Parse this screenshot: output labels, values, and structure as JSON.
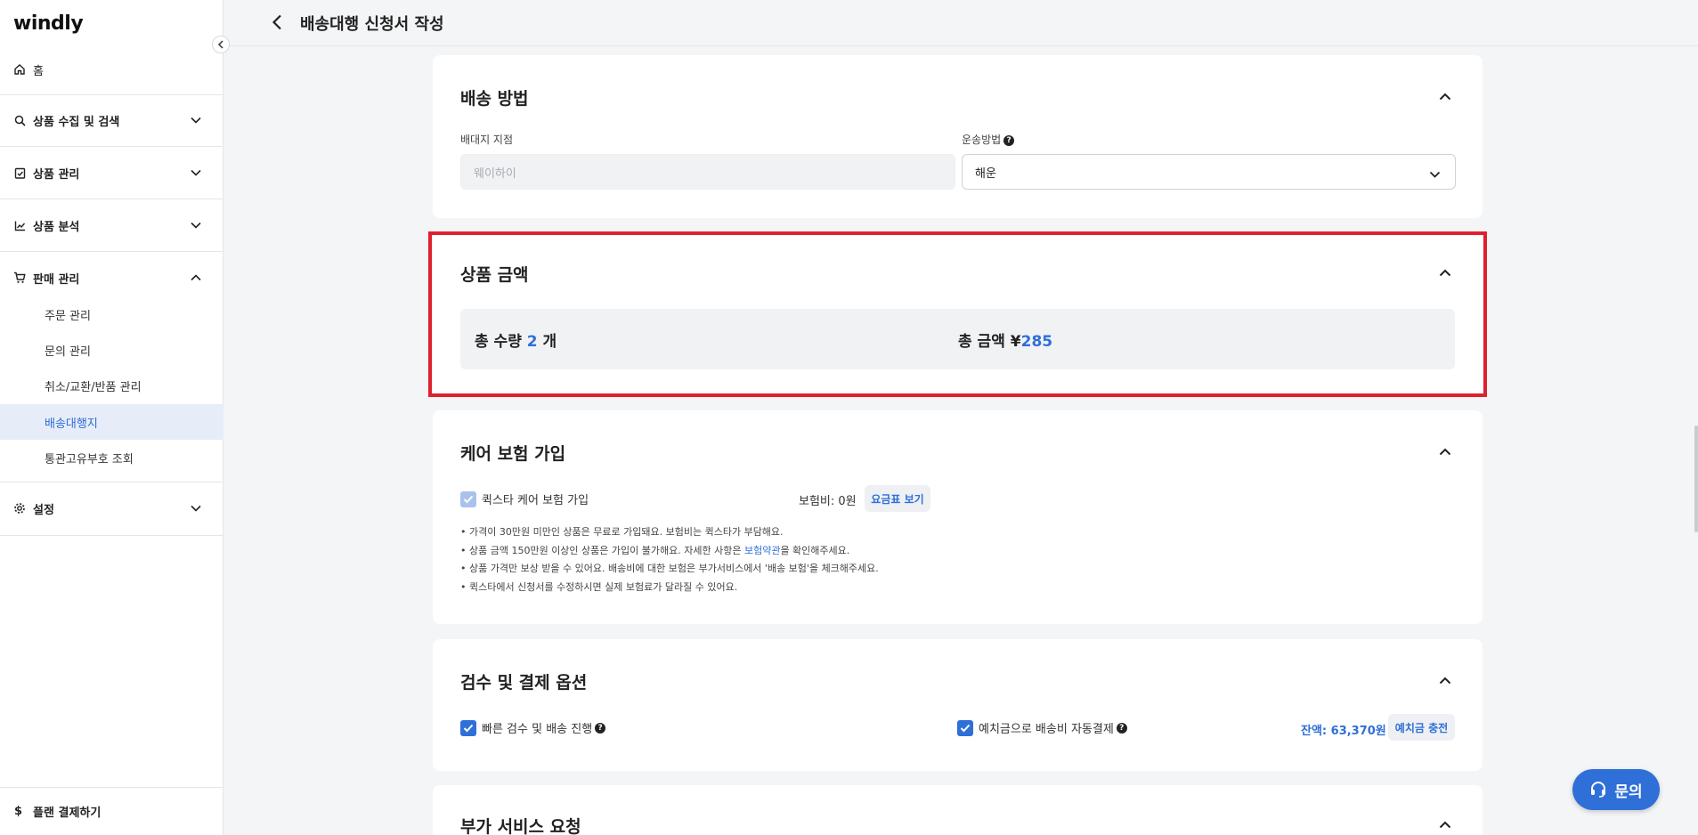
{
  "sidebar": {
    "logo": "windly",
    "home": "홈",
    "items": [
      {
        "label": "상품 수집 및 검색"
      },
      {
        "label": "상품 관리"
      },
      {
        "label": "상품 분석"
      },
      {
        "label": "판매 관리"
      },
      {
        "label": "설정"
      }
    ],
    "sub_items": [
      {
        "label": "주문 관리"
      },
      {
        "label": "문의 관리"
      },
      {
        "label": "취소/교환/반품 관리"
      },
      {
        "label": "배송대행지",
        "active": true
      },
      {
        "label": "통관고유부호 조회"
      }
    ],
    "plan_label": "플랜 결제하기",
    "plan_symbol": "$"
  },
  "header": {
    "title": "배송대행 신청서 작성"
  },
  "shipping": {
    "title": "배송 방법",
    "warehouse_label": "배대지 지점",
    "warehouse_placeholder": "웨이하이",
    "method_label": "운송방법",
    "method_value": "해운"
  },
  "product_amount": {
    "title": "상품 금액",
    "qty_label": "총 수량",
    "qty_value": "2",
    "qty_unit": "개",
    "total_label": "총 금액",
    "currency": "¥",
    "total_value": "285"
  },
  "insurance": {
    "title": "케어 보험 가입",
    "checkbox_label": "퀵스타 케어 보험 가입",
    "fee_label": "보험비: 0원",
    "fee_table_button": "요금표 보기",
    "notes": [
      "• 가격이 30만원 미만인 상품은 무료로 가입돼요. 보험비는 퀵스타가 부담해요.",
      "• 상품 금액 150만원 이상인 상품은 가입이 불가해요. 자세한 사항은 ",
      "• 상품 가격만 보상 받을 수 있어요. 배송비에 대한 보험은 부가서비스에서 '배송 보험'을 체크해주세요.",
      "• 퀵스타에서 신청서를 수정하시면 실제 보험료가 달라질 수 있어요."
    ],
    "note2_link": "보험약관",
    "note2_suffix": "을 확인해주세요."
  },
  "inspection": {
    "title": "검수 및 결제 옵션",
    "fast_label": "빠른 검수 및 배송 진행",
    "auto_pay_label": "예치금으로 배송비 자동결제",
    "balance": "잔액: 63,370원",
    "charge_button": "예치금 충전"
  },
  "extra": {
    "title": "부가 서비스 요청"
  },
  "fab": {
    "label": "문의"
  },
  "colors": {
    "accent": "#2f6fd8",
    "highlight": "#e0202e",
    "active_bg": "#e6edf8"
  }
}
